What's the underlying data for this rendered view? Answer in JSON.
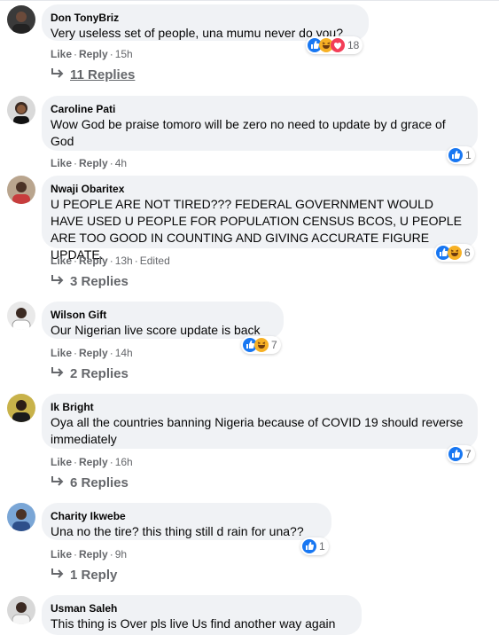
{
  "colors": {
    "like_blue": "#1877f2",
    "love_red": "#f33e58",
    "haha_yellow": "#f7b125",
    "meta_gray": "#65676b",
    "bubble_gray": "#f0f2f5"
  },
  "labels": {
    "like": "Like",
    "reply": "Reply",
    "sep": "·"
  },
  "comments": [
    {
      "name": "Don TonyBriz",
      "text": "Very useless set of people, una mumu never do you?",
      "time": "15h",
      "edited": "",
      "reactions": [
        "like",
        "haha",
        "love"
      ],
      "count": "18",
      "replies": "11 Replies",
      "avatar": "man-dark"
    },
    {
      "name": "Caroline Pati",
      "text": "Wow God be praise tomoro will be zero no need to update by d grace of God",
      "time": "4h",
      "edited": "",
      "reactions": [
        "like"
      ],
      "count": "1",
      "replies": "",
      "avatar": "woman"
    },
    {
      "name": "Nwaji Obaritex",
      "text": "U PEOPLE ARE NOT TIRED??? FEDERAL GOVERNMENT WOULD HAVE USED U PEOPLE FOR POPULATION CENSUS BCOS, U PEOPLE ARE TOO GOOD IN COUNTING AND GIVING ACCURATE FIGURE UPDATE.",
      "time": "13h",
      "edited": "Edited",
      "reactions": [
        "like",
        "haha"
      ],
      "count": "6",
      "replies": "3 Replies",
      "avatar": "woman-2"
    },
    {
      "name": "Wilson Gift",
      "text": "Our Nigerian live score update is back",
      "time": "14h",
      "edited": "",
      "reactions": [
        "like",
        "haha"
      ],
      "count": "7",
      "replies": "2 Replies",
      "avatar": "man-light"
    },
    {
      "name": "Ik Bright",
      "text": "Oya all the countries banning Nigeria because of COVID 19 should reverse immediately",
      "time": "16h",
      "edited": "",
      "reactions": [
        "like"
      ],
      "count": "7",
      "replies": "6 Replies",
      "avatar": "man-yellow"
    },
    {
      "name": "Charity Ikwebe",
      "text": "Una no the tire? this thing still d rain for una??",
      "time": "9h",
      "edited": "",
      "reactions": [
        "like"
      ],
      "count": "1",
      "replies": "1 Reply",
      "avatar": "woman-blue"
    },
    {
      "name": "Usman Saleh",
      "text": "This thing is Over pls live Us find another way again",
      "time": "",
      "edited": "",
      "reactions": [],
      "count": "",
      "replies": "",
      "avatar": "man-white"
    }
  ]
}
